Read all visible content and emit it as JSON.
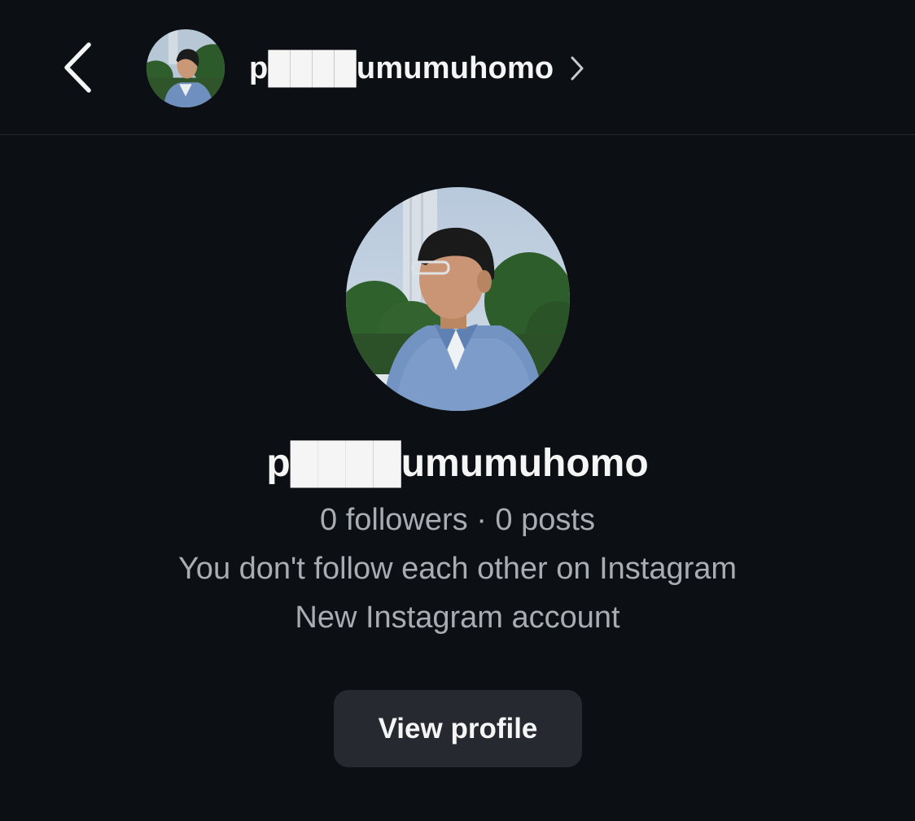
{
  "header": {
    "back_icon": "chevron-left-icon",
    "username": "p████umumuhomo",
    "chevron_icon": "chevron-right-icon"
  },
  "profile": {
    "username": "p████umumuhomo",
    "stats": "0 followers · 0 posts",
    "follow_info": "You don't follow each other on Instagram",
    "account_info": "New Instagram account",
    "view_profile_label": "View profile"
  },
  "colors": {
    "background": "#0c1014",
    "primary_text": "#f5f5f5",
    "secondary_text": "#a8adb4",
    "button_bg": "#262a30",
    "redaction": "#d9d9d9"
  }
}
